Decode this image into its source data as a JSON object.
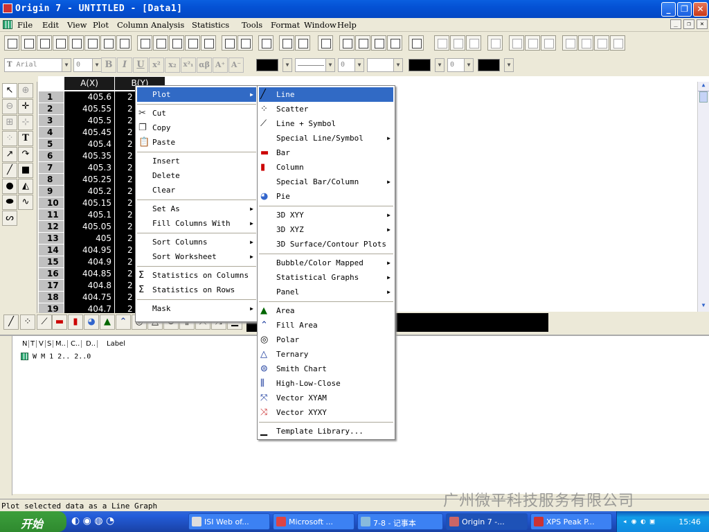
{
  "window": {
    "title": "Origin 7 - UNTITLED - [Data1]",
    "minimize": "_",
    "restore": "❐",
    "close": "✕"
  },
  "menubar": {
    "items": [
      "File",
      "Edit",
      "View",
      "Plot",
      "Column",
      "Analysis",
      "Statistics",
      "Tools",
      "Format",
      "Window",
      "Help"
    ]
  },
  "format_toolbar": {
    "font": "Arial",
    "size": "0",
    "bold": "B",
    "italic": "I",
    "underline": "U",
    "sup": "x²",
    "sub": "x₂",
    "supsub": "x²₁",
    "greek": "αβ",
    "grow": "A⁺",
    "shrink": "A⁻",
    "line_width": "0",
    "thickness": "0"
  },
  "worksheet": {
    "col_a": "A(X)",
    "col_b": "B(Y)",
    "rows": [
      {
        "n": "1",
        "a": "405.6",
        "b": "2"
      },
      {
        "n": "2",
        "a": "405.55",
        "b": "2"
      },
      {
        "n": "3",
        "a": "405.5",
        "b": "2"
      },
      {
        "n": "4",
        "a": "405.45",
        "b": "2"
      },
      {
        "n": "5",
        "a": "405.4",
        "b": "2"
      },
      {
        "n": "6",
        "a": "405.35",
        "b": "2"
      },
      {
        "n": "7",
        "a": "405.3",
        "b": "2"
      },
      {
        "n": "8",
        "a": "405.25",
        "b": "2"
      },
      {
        "n": "9",
        "a": "405.2",
        "b": "2"
      },
      {
        "n": "10",
        "a": "405.15",
        "b": "2"
      },
      {
        "n": "11",
        "a": "405.1",
        "b": "2"
      },
      {
        "n": "12",
        "a": "405.05",
        "b": "2"
      },
      {
        "n": "13",
        "a": "405",
        "b": "2"
      },
      {
        "n": "14",
        "a": "404.95",
        "b": "2"
      },
      {
        "n": "15",
        "a": "404.9",
        "b": "2"
      },
      {
        "n": "16",
        "a": "404.85",
        "b": "2"
      },
      {
        "n": "17",
        "a": "404.8",
        "b": "2"
      },
      {
        "n": "18",
        "a": "404.75",
        "b": "2"
      },
      {
        "n": "19",
        "a": "404.7",
        "b": "2"
      }
    ]
  },
  "project_explorer": {
    "columns": [
      "N",
      "T",
      "V",
      "S",
      "M..",
      "C..",
      "D..",
      "Label"
    ],
    "row": "W M 1 2.. 2..0"
  },
  "context_menu": {
    "items": [
      {
        "label": "Plot",
        "submenu": true,
        "highlight": true
      },
      {
        "label": "Cut",
        "icon": "scissors-icon"
      },
      {
        "label": "Copy",
        "icon": "copy-icon"
      },
      {
        "label": "Paste",
        "icon": "paste-icon"
      },
      {
        "label": "Insert"
      },
      {
        "label": "Delete"
      },
      {
        "label": "Clear"
      },
      {
        "label": "Set As",
        "submenu": true
      },
      {
        "label": "Fill Columns With",
        "submenu": true
      },
      {
        "label": "Sort Columns",
        "submenu": true
      },
      {
        "label": "Sort Worksheet",
        "submenu": true
      },
      {
        "label": "Statistics on Columns",
        "icon": "sigma-icon"
      },
      {
        "label": "Statistics on Rows",
        "icon": "sigma-rows-icon"
      },
      {
        "label": "Mask",
        "submenu": true
      }
    ]
  },
  "plot_submenu": {
    "items": [
      {
        "label": "Line",
        "icon": "line-icon",
        "highlight": true
      },
      {
        "label": "Scatter",
        "icon": "scatter-icon"
      },
      {
        "label": "Line + Symbol",
        "icon": "line-symbol-icon"
      },
      {
        "label": "Special Line/Symbol",
        "submenu": true
      },
      {
        "label": "Bar",
        "icon": "bar-icon"
      },
      {
        "label": "Column",
        "icon": "column-icon"
      },
      {
        "label": "Special Bar/Column",
        "submenu": true
      },
      {
        "label": "Pie",
        "icon": "pie-icon"
      },
      {
        "label": "3D XYY",
        "submenu": true
      },
      {
        "label": "3D XYZ",
        "submenu": true
      },
      {
        "label": "3D Surface/Contour Plots"
      },
      {
        "label": "Bubble/Color Mapped",
        "submenu": true
      },
      {
        "label": "Statistical Graphs",
        "submenu": true
      },
      {
        "label": "Panel",
        "submenu": true
      },
      {
        "label": "Area",
        "icon": "area-icon"
      },
      {
        "label": "Fill Area",
        "icon": "fill-area-icon"
      },
      {
        "label": "Polar",
        "icon": "polar-icon"
      },
      {
        "label": "Ternary",
        "icon": "ternary-icon"
      },
      {
        "label": "Smith Chart",
        "icon": "smith-chart-icon"
      },
      {
        "label": "High-Low-Close",
        "icon": "high-low-close-icon"
      },
      {
        "label": "Vector XYAM",
        "icon": "vector-xyam-icon"
      },
      {
        "label": "Vector XYXY",
        "icon": "vector-xyxy-icon"
      },
      {
        "label": "Template Library...",
        "icon": "template-icon"
      }
    ]
  },
  "status_bar": {
    "text": "Plot selected data as a Line Graph"
  },
  "taskbar": {
    "start": "开始",
    "tasks": [
      "ISI Web of...",
      "Microsoft ...",
      "7-8 - 记事本",
      "Origin 7 -...",
      "XPS Peak P..."
    ],
    "clock": "15:46"
  },
  "watermark": "广州微平科技服务有限公司",
  "colors": {
    "menu_highlight": "#316ac5",
    "titlebar": "#0451d4",
    "sheet_black": "#000000"
  }
}
